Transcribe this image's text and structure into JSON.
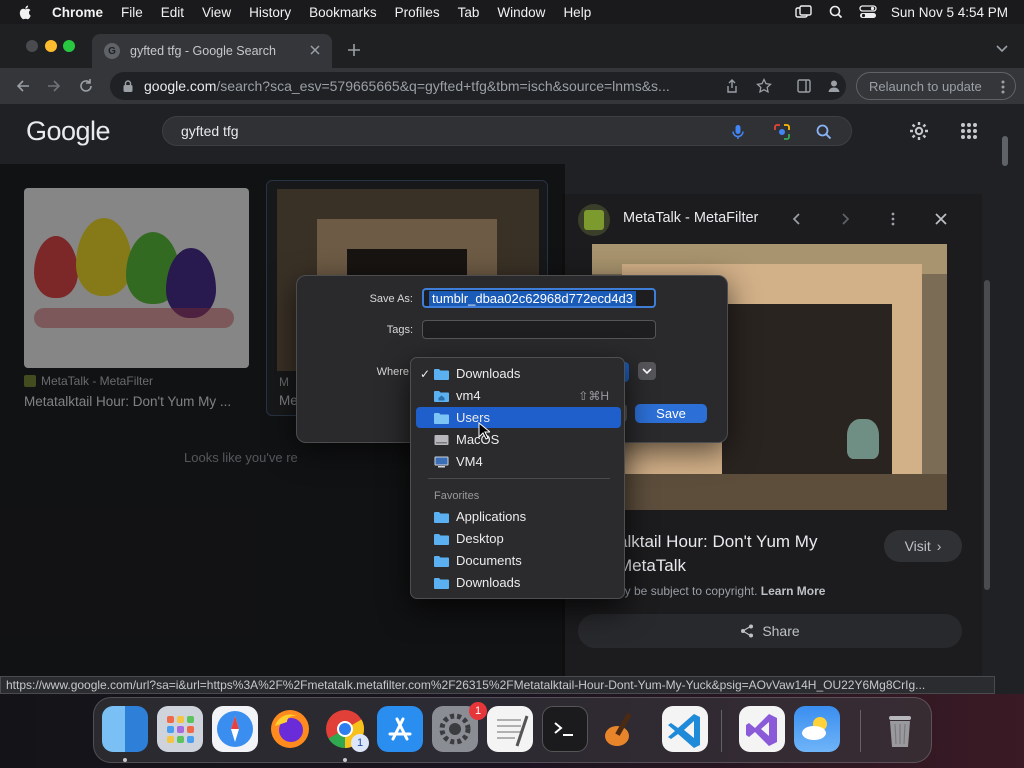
{
  "menubar": {
    "items": [
      "Chrome",
      "File",
      "Edit",
      "View",
      "History",
      "Bookmarks",
      "Profiles",
      "Tab",
      "Window",
      "Help"
    ],
    "clock": "Sun Nov 5  4:54 PM"
  },
  "browser": {
    "tab_title": "gyfted tfg - Google Search",
    "url_host": "google.com",
    "url_rest": "/search?sca_esv=579665665&q=gyfted+tfg&tbm=isch&source=lnms&s...",
    "relaunch_label": "Relaunch to update"
  },
  "google": {
    "logo": "Google",
    "query": "gyfted tfg",
    "result1": {
      "source": "MetaTalk - MetaFilter",
      "caption": "Metatalktail Hour: Don't Yum My ..."
    },
    "result2": {
      "source": "M",
      "caption": "Me"
    },
    "no_more": "Looks like you've re"
  },
  "panel": {
    "site": "MetaTalk - MetaFilter",
    "title_line1": "alktail Hour: Don't Yum My",
    "title_line2": "MetaTalk",
    "visit_label": "Visit",
    "copyright": "ay be subject to copyright.",
    "learn_more": "Learn More",
    "share_label": "Share"
  },
  "status_url": "https://www.google.com/url?sa=i&url=https%3A%2F%2Fmetatalk.metafilter.com%2F26315%2FMetatalktail-Hour-Dont-Yum-My-Yuck&psig=AOvVaw14H_OU22Y6Mg8CrIg...",
  "dialog": {
    "save_as_label": "Save As:",
    "save_as_value": "tumblr_dbaa02c62968d772ecd4d3",
    "tags_label": "Tags:",
    "where_label": "Where",
    "save_label": "Save"
  },
  "where_menu": {
    "items": [
      {
        "label": "Downloads",
        "checked": true,
        "icon": "folder-icon"
      },
      {
        "label": "vm4",
        "shortcut": "⇧⌘H",
        "icon": "home-folder-icon"
      },
      {
        "label": "Users",
        "highlighted": true,
        "icon": "folder-icon"
      },
      {
        "label": "MacOS",
        "icon": "disk-icon"
      },
      {
        "label": "VM4",
        "icon": "computer-icon"
      }
    ],
    "favorites_header": "Favorites",
    "favorites": [
      "Applications",
      "Desktop",
      "Documents",
      "Downloads"
    ]
  },
  "dock": {
    "apps": [
      "Finder",
      "Launchpad",
      "Safari",
      "Firefox",
      "Chrome",
      "App Store",
      "System Settings",
      "TextEdit",
      "Terminal",
      "GarageBand",
      "Visual Studio Code",
      "Visual Studio",
      "Weather",
      "Trash"
    ],
    "chrome_badge": "1",
    "settings_badge": "1"
  },
  "colors": {
    "accent": "#2c6fd6",
    "highlight": "#1f5fcc"
  }
}
